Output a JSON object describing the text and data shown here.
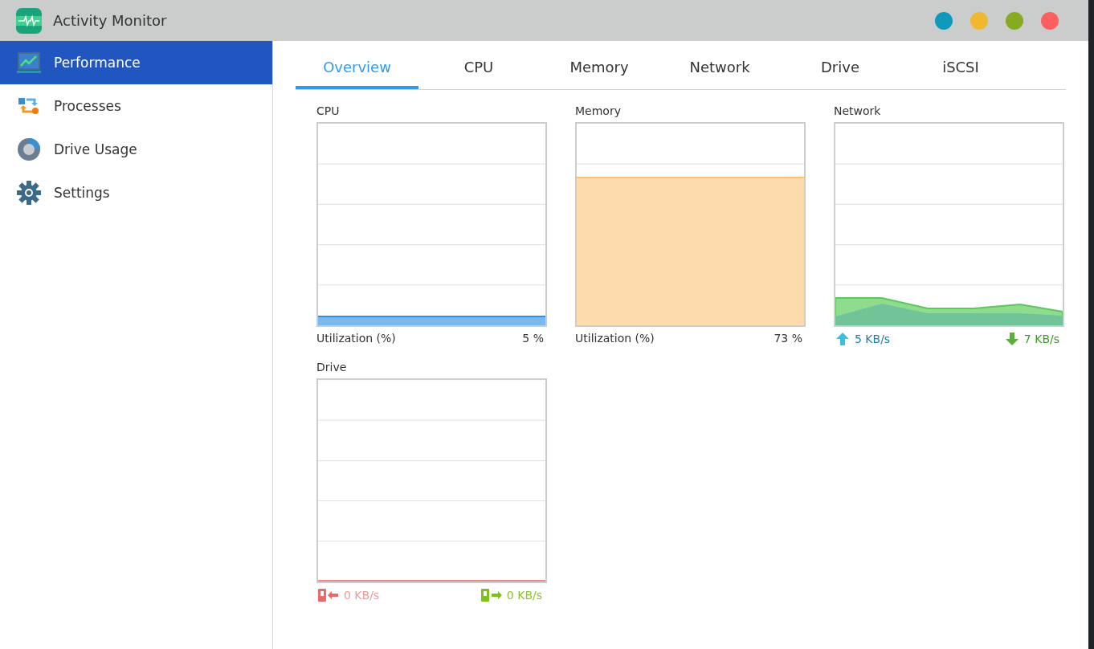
{
  "window": {
    "title": "Activity Monitor",
    "controls": [
      {
        "color": "#1199bb"
      },
      {
        "color": "#f0b830"
      },
      {
        "color": "#88aa22"
      },
      {
        "color": "#ff5f5f"
      }
    ]
  },
  "sidebar": {
    "items": [
      {
        "label": "Performance",
        "selected": true
      },
      {
        "label": "Processes",
        "selected": false
      },
      {
        "label": "Drive Usage",
        "selected": false
      },
      {
        "label": "Settings",
        "selected": false
      }
    ]
  },
  "tabs": [
    {
      "label": "Overview",
      "selected": true
    },
    {
      "label": "CPU",
      "selected": false
    },
    {
      "label": "Memory",
      "selected": false
    },
    {
      "label": "Network",
      "selected": false
    },
    {
      "label": "Drive",
      "selected": false
    },
    {
      "label": "iSCSI",
      "selected": false
    }
  ],
  "panels": [
    {
      "kind": "utilization",
      "title": "CPU",
      "caption": "Utilization (%)",
      "reading": "5 %"
    },
    {
      "kind": "utilization",
      "title": "Memory",
      "caption": "Utilization (%)",
      "reading": "73 %"
    },
    {
      "kind": "network",
      "title": "Network",
      "upload": "5 KB/s",
      "download": "7 KB/s"
    },
    {
      "kind": "drive",
      "title": "Drive",
      "read": "0 KB/s",
      "write": "0 KB/s"
    }
  ]
}
